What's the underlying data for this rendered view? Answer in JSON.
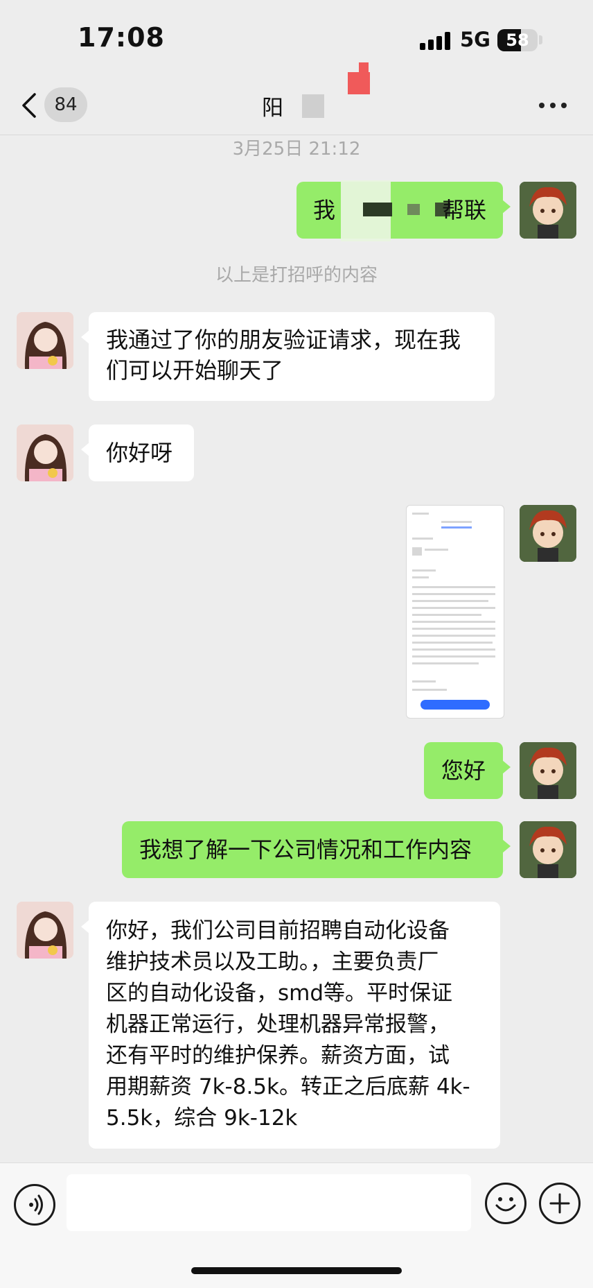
{
  "status_bar": {
    "time": "17:08",
    "network": "5G",
    "battery": "58",
    "battery_fraction": 0.58
  },
  "nav": {
    "unread_count": "84",
    "title": "阳"
  },
  "chat": {
    "timestamp": "3月25日 21:12",
    "system_note": "以上是打招呼的内容",
    "messages": [
      {
        "sender": "self",
        "text_start": "我",
        "text_end": "帮联"
      },
      {
        "sender": "other",
        "line1": "我通过了你的朋友验证请求，现在我",
        "line2": "们可以开始聊天了"
      },
      {
        "sender": "other",
        "text": "你好呀"
      },
      {
        "sender": "self",
        "type": "image"
      },
      {
        "sender": "self",
        "text": "您好"
      },
      {
        "sender": "self",
        "text": "我想了解一下公司情况和工作内容"
      },
      {
        "sender": "other",
        "lines": [
          "你好，我们公司目前招聘自动化设备",
          "维护技术员以及工助。，主要负责厂",
          "区的自动化设备，smd等。平时保证",
          "机器正常运行，处理机器异常报警，",
          "还有平时的维护保养。薪资方面，试",
          "用期薪资 7k-8.5k。转正之后底薪 4k-",
          "5.5k，综合 9k-12k"
        ]
      }
    ]
  },
  "input": {
    "placeholder": ""
  },
  "icons": {
    "back": "chevron-left-icon",
    "more": "more-dots-icon",
    "voice": "voice-icon",
    "emoji": "emoji-icon",
    "add": "plus-icon"
  }
}
